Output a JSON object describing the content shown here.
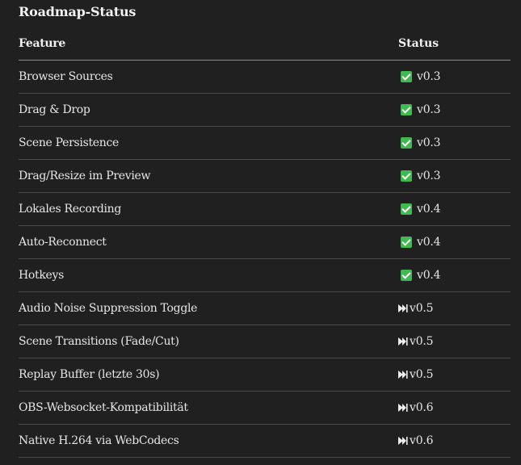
{
  "title": "Roadmap-Status",
  "table": {
    "headers": {
      "feature": "Feature",
      "status": "Status"
    },
    "rows": [
      {
        "feature": "Browser Sources",
        "status": "done",
        "version": "v0.3"
      },
      {
        "feature": "Drag & Drop",
        "status": "done",
        "version": "v0.3"
      },
      {
        "feature": "Scene Persistence",
        "status": "done",
        "version": "v0.3"
      },
      {
        "feature": "Drag/Resize im Preview",
        "status": "done",
        "version": "v0.3"
      },
      {
        "feature": "Lokales Recording",
        "status": "done",
        "version": "v0.4"
      },
      {
        "feature": "Auto-Reconnect",
        "status": "done",
        "version": "v0.4"
      },
      {
        "feature": "Hotkeys",
        "status": "done",
        "version": "v0.4"
      },
      {
        "feature": "Audio Noise Suppression Toggle",
        "status": "planned",
        "version": "v0.5"
      },
      {
        "feature": "Scene Transitions (Fade/Cut)",
        "status": "planned",
        "version": "v0.5"
      },
      {
        "feature": "Replay Buffer (letzte 30s)",
        "status": "planned",
        "version": "v0.5"
      },
      {
        "feature": "OBS-Websocket-Kompatibilität",
        "status": "planned",
        "version": "v0.6"
      },
      {
        "feature": "Native H.264 via WebCodecs",
        "status": "planned",
        "version": "v0.6"
      }
    ]
  },
  "icons": {
    "done": "white-check-mark-green-box-icon",
    "planned": "next-track-icon"
  },
  "colors": {
    "background": "#202020",
    "text": "#ececec",
    "check_green": "#3fb950"
  }
}
